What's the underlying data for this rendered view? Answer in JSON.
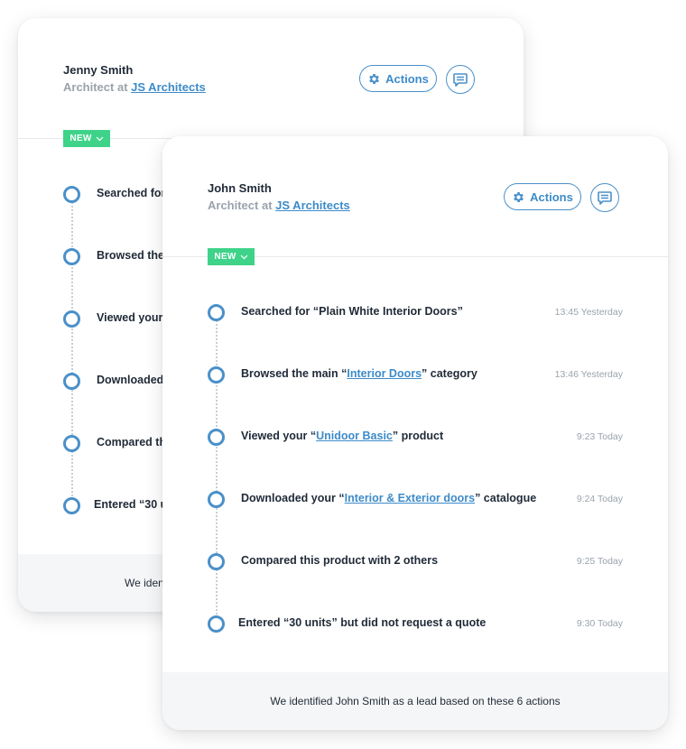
{
  "back_card": {
    "name": "Jenny Smith",
    "role_prefix": "Architect at",
    "company": "JS Architects",
    "actions_label": "Actions",
    "badge": "NEW",
    "timeline": [
      {
        "text": "Searched for"
      },
      {
        "text": "Browsed the"
      },
      {
        "text": "Viewed your"
      },
      {
        "text": "Downloaded"
      },
      {
        "text": "Compared th"
      },
      {
        "text": "Entered “30 u"
      }
    ],
    "footer": "We iden"
  },
  "front_card": {
    "name": "John Smith",
    "role_prefix": "Architect at",
    "company": "JS Architects",
    "actions_label": "Actions",
    "badge": "NEW",
    "timeline": [
      {
        "pre": "Searched for “Plain White Interior Doors”",
        "link": "",
        "post": "",
        "time": "13:45 Yesterday"
      },
      {
        "pre": "Browsed the main “",
        "link": "Interior Doors",
        "post": "” category",
        "time": "13:46 Yesterday"
      },
      {
        "pre": "Viewed your “",
        "link": "Unidoor Basic",
        "post": "” product",
        "time": "9:23 Today"
      },
      {
        "pre": "Downloaded your “",
        "link": "Interior & Exterior doors",
        "post": "” catalogue",
        "time": "9:24 Today"
      },
      {
        "pre": "Compared this product with 2 others",
        "link": "",
        "post": "",
        "time": "9:25 Today"
      },
      {
        "pre": "Entered “30 units” but did not request a quote",
        "link": "",
        "post": "",
        "time": "9:30 Today"
      }
    ],
    "footer": "We identified John Smith as a lead based on these 6 actions"
  },
  "colors": {
    "accent": "#4a90c9",
    "link": "#3d8bc9",
    "badge": "#3fd38a",
    "muted": "#9aa3ad"
  },
  "icons": {
    "actions": "gear-icon",
    "message": "chat-bubble-icon",
    "badge_dropdown": "chevron-down-icon"
  }
}
